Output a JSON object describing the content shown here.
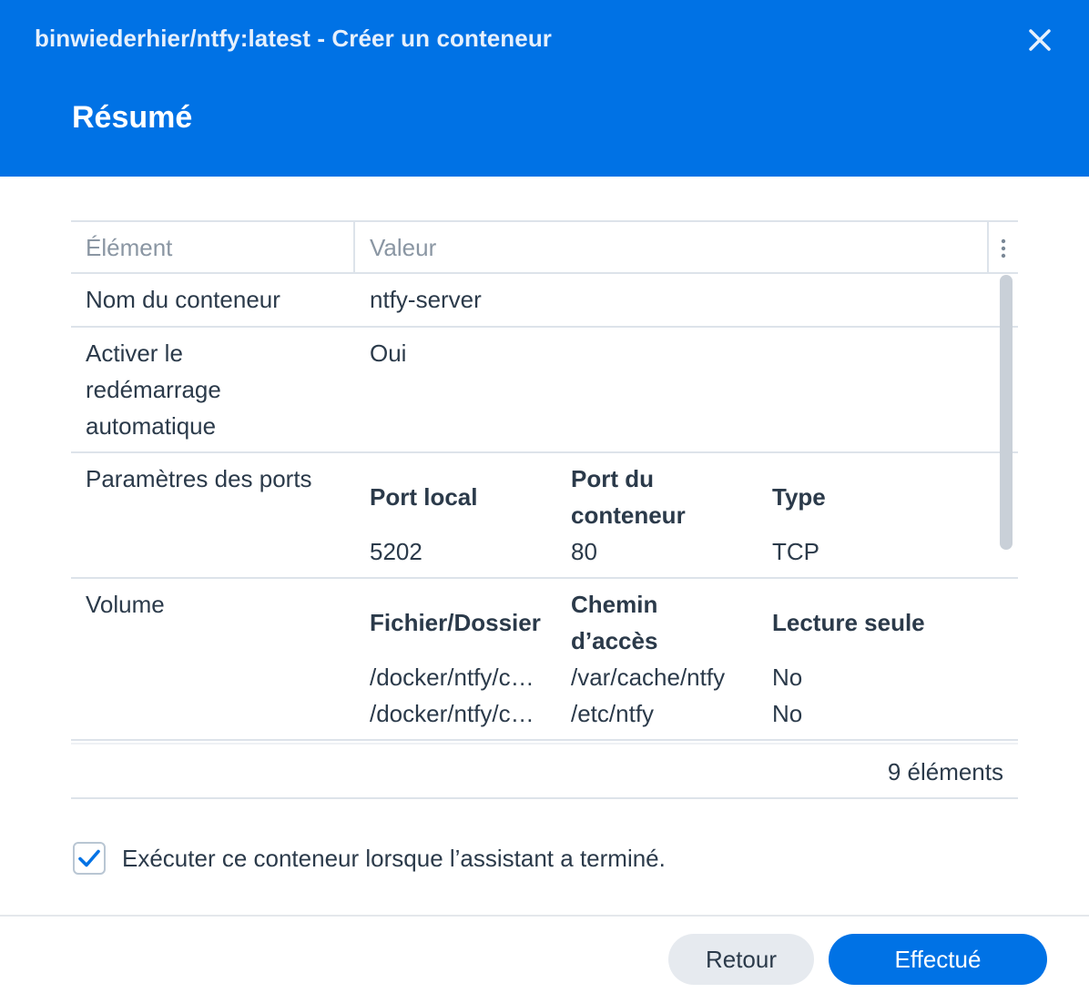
{
  "window": {
    "title": "binwiederhier/ntfy:latest - Créer un conteneur",
    "close_icon": "close-icon"
  },
  "page": {
    "title": "Résumé"
  },
  "table": {
    "headers": {
      "element": "Élément",
      "value": "Valeur"
    },
    "rows": {
      "name": {
        "element": "Nom du conteneur",
        "value": "ntfy-server"
      },
      "restart": {
        "element": "Activer le redémarrage automatique",
        "value": "Oui"
      },
      "ports": {
        "element": "Paramètres des ports",
        "headers": [
          "Port local",
          "Port du conteneur",
          "Type"
        ],
        "values": [
          [
            "5202",
            "80",
            "TCP"
          ]
        ]
      },
      "volume": {
        "element": "Volume",
        "headers": [
          "Fichier/Dossier",
          "Chemin d’accès",
          "Lecture seule"
        ],
        "values": [
          [
            "/docker/ntfy/c…",
            "/var/cache/ntfy",
            "No"
          ],
          [
            "/docker/ntfy/c…",
            "/etc/ntfy",
            "No"
          ]
        ]
      }
    },
    "count": "9 éléments"
  },
  "run_checkbox": {
    "label": "Exécuter ce conteneur lorsque l’assistant a terminé.",
    "checked": true
  },
  "buttons": {
    "back": "Retour",
    "done": "Effectué"
  },
  "colors": {
    "accent": "#0072e5",
    "header_bg": "#0072e5"
  }
}
